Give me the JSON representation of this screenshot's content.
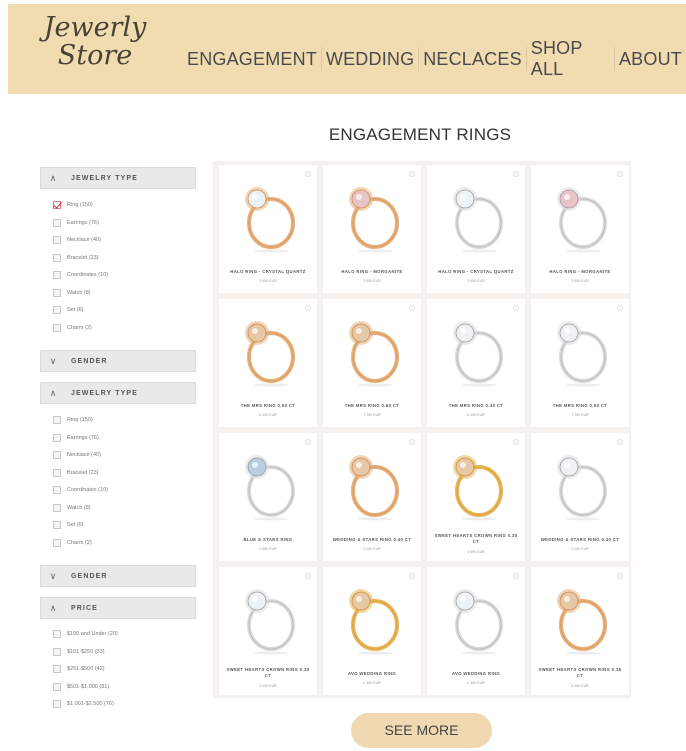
{
  "header": {
    "logo_line1": "Jewerly",
    "logo_line2": "Store",
    "nav": [
      "ENGAGEMENT",
      "WEDDING",
      "NECLACES",
      "SHOP ALL",
      "ABOUT"
    ]
  },
  "page_title": "ENGAGEMENT RINGS",
  "sidebar": {
    "jewelry_type_1": {
      "title": "JEWELRY TYPE",
      "options": [
        {
          "label": "Ring (150)",
          "checked": true
        },
        {
          "label": "Earrings (76)",
          "checked": false
        },
        {
          "label": "Necklace (40)",
          "checked": false
        },
        {
          "label": "Bracelet (23)",
          "checked": false
        },
        {
          "label": "Coordinates (10)",
          "checked": false
        },
        {
          "label": "Watch (8)",
          "checked": false
        },
        {
          "label": "Set (6)",
          "checked": false
        },
        {
          "label": "Charm (2)",
          "checked": false
        }
      ]
    },
    "gender_1": {
      "title": "GENDER"
    },
    "jewelry_type_2": {
      "title": "JEWELRY TYPE",
      "options": [
        {
          "label": "Ring (150)",
          "checked": false
        },
        {
          "label": "Earrings (76)",
          "checked": false
        },
        {
          "label": "Necklace (40)",
          "checked": false
        },
        {
          "label": "Bracelet (23)",
          "checked": false
        },
        {
          "label": "Coordinates (10)",
          "checked": false
        },
        {
          "label": "Watch (8)",
          "checked": false
        },
        {
          "label": "Set (6)",
          "checked": false
        },
        {
          "label": "Charm (2)",
          "checked": false
        }
      ]
    },
    "gender_2": {
      "title": "GENDER"
    },
    "price": {
      "title": "PRICE",
      "options": [
        {
          "label": "$100 and Under (20)",
          "checked": false
        },
        {
          "label": "$101-$250 (33)",
          "checked": false
        },
        {
          "label": "$251-$500 (42)",
          "checked": false
        },
        {
          "label": "$501-$1,000 (81)",
          "checked": false
        },
        {
          "label": "$1,001-$2,500 (76)",
          "checked": false
        }
      ]
    }
  },
  "products": [
    {
      "name": "HALO RING - CRYSTAL QUARTZ",
      "price": "3 950 EUR",
      "metal": "rose",
      "stone": "clear"
    },
    {
      "name": "HALO RING - MORGANITE",
      "price": "3 950 EUR",
      "metal": "rose",
      "stone": "pink"
    },
    {
      "name": "HALO RING - CRYSTAL QUARTZ",
      "price": "3 950 EUR",
      "metal": "white",
      "stone": "clear"
    },
    {
      "name": "HALO RING - MORGANITE",
      "price": "3 900 EUR",
      "metal": "white",
      "stone": "pink"
    },
    {
      "name": "THE MRS RING 0.50 CT",
      "price": "6 420 EUR",
      "metal": "rose",
      "stone": "champagne"
    },
    {
      "name": "THE MRS RING 0.60 CT",
      "price": "7 750 EUR",
      "metal": "rose",
      "stone": "champagne"
    },
    {
      "name": "THE MRS RING 0.30 CT",
      "price": "6 490 EUR",
      "metal": "white",
      "stone": "clear"
    },
    {
      "name": "THE MRS RING 0.50 CT",
      "price": "7 750 EUR",
      "metal": "white",
      "stone": "clear"
    },
    {
      "name": "BLUE & STARS RING",
      "price": "2 650 EUR",
      "metal": "white",
      "stone": "blue"
    },
    {
      "name": "WEDDING & STARS RING 0.40 CT",
      "price": "4 200 EUR",
      "metal": "rose",
      "stone": "champagne"
    },
    {
      "name": "SWEET HEARTS CROWN RING 0.30 CT",
      "price": "4 690 EUR",
      "metal": "gold",
      "stone": "champagne"
    },
    {
      "name": "WEDDING & STARS RING 0.30 CT",
      "price": "4 200 EUR",
      "metal": "white",
      "stone": "clear"
    },
    {
      "name": "SWEET HEARTS CROWN RING 0.30 CT",
      "price": "4 220 EUR",
      "metal": "white",
      "stone": "clear"
    },
    {
      "name": "AVO WEDDING RING",
      "price": "2 300 EUR",
      "metal": "gold",
      "stone": "champagne"
    },
    {
      "name": "AVO WEDDING RING",
      "price": "2 300 EUR",
      "metal": "white",
      "stone": "clear"
    },
    {
      "name": "SWEET HEARTS CROWN RING 0.35 CT",
      "price": "5 260 EUR",
      "metal": "rose",
      "stone": "champagne"
    }
  ],
  "see_more_label": "SEE MORE",
  "icons": {
    "collapse": "chevron-up-icon",
    "expand": "chevron-down-icon",
    "favorite": "heart-icon",
    "checkbox": "checkbox-icon"
  },
  "colors": {
    "header_bg": "#f1dbb0",
    "button_bg": "#f0d9b0",
    "grid_bg": "#f4f1ee",
    "check": "#d93030"
  }
}
